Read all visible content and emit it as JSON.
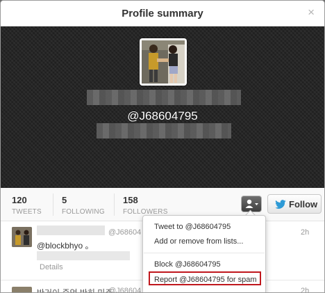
{
  "modal": {
    "title": "Profile summary",
    "close_glyph": "×"
  },
  "profile": {
    "screen_name": "@J68604795"
  },
  "stats": [
    {
      "value": "120",
      "label": "TWEETS"
    },
    {
      "value": "5",
      "label": "FOLLOWING"
    },
    {
      "value": "158",
      "label": "FOLLOWERS"
    }
  ],
  "actions": {
    "follow_label": "Follow",
    "user_menu_icon": "person-icon"
  },
  "dropdown": {
    "items": [
      "Tweet to @J68604795",
      "Add or remove from lists...",
      "Block @J68604795",
      "Report @J68604795 for spam"
    ]
  },
  "tweets": [
    {
      "handle": "@J68604",
      "time": "2h",
      "text": "@blockbhyo 。",
      "details": "Details"
    },
    {
      "handle": "@J68604",
      "time": "2h",
      "text": "반거이 죽었 반히 미쥬"
    }
  ],
  "colors": {
    "twitter_blue": "#1da1f2",
    "report_highlight": "#c0171d"
  }
}
